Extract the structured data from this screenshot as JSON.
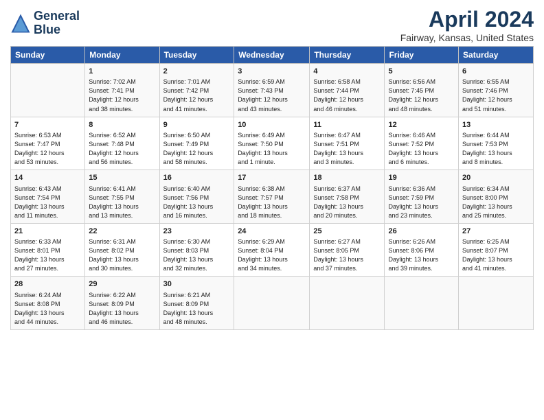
{
  "header": {
    "logo_line1": "General",
    "logo_line2": "Blue",
    "title": "April 2024",
    "subtitle": "Fairway, Kansas, United States"
  },
  "columns": [
    "Sunday",
    "Monday",
    "Tuesday",
    "Wednesday",
    "Thursday",
    "Friday",
    "Saturday"
  ],
  "weeks": [
    [
      {
        "num": "",
        "info": ""
      },
      {
        "num": "1",
        "info": "Sunrise: 7:02 AM\nSunset: 7:41 PM\nDaylight: 12 hours\nand 38 minutes."
      },
      {
        "num": "2",
        "info": "Sunrise: 7:01 AM\nSunset: 7:42 PM\nDaylight: 12 hours\nand 41 minutes."
      },
      {
        "num": "3",
        "info": "Sunrise: 6:59 AM\nSunset: 7:43 PM\nDaylight: 12 hours\nand 43 minutes."
      },
      {
        "num": "4",
        "info": "Sunrise: 6:58 AM\nSunset: 7:44 PM\nDaylight: 12 hours\nand 46 minutes."
      },
      {
        "num": "5",
        "info": "Sunrise: 6:56 AM\nSunset: 7:45 PM\nDaylight: 12 hours\nand 48 minutes."
      },
      {
        "num": "6",
        "info": "Sunrise: 6:55 AM\nSunset: 7:46 PM\nDaylight: 12 hours\nand 51 minutes."
      }
    ],
    [
      {
        "num": "7",
        "info": "Sunrise: 6:53 AM\nSunset: 7:47 PM\nDaylight: 12 hours\nand 53 minutes."
      },
      {
        "num": "8",
        "info": "Sunrise: 6:52 AM\nSunset: 7:48 PM\nDaylight: 12 hours\nand 56 minutes."
      },
      {
        "num": "9",
        "info": "Sunrise: 6:50 AM\nSunset: 7:49 PM\nDaylight: 12 hours\nand 58 minutes."
      },
      {
        "num": "10",
        "info": "Sunrise: 6:49 AM\nSunset: 7:50 PM\nDaylight: 13 hours\nand 1 minute."
      },
      {
        "num": "11",
        "info": "Sunrise: 6:47 AM\nSunset: 7:51 PM\nDaylight: 13 hours\nand 3 minutes."
      },
      {
        "num": "12",
        "info": "Sunrise: 6:46 AM\nSunset: 7:52 PM\nDaylight: 13 hours\nand 6 minutes."
      },
      {
        "num": "13",
        "info": "Sunrise: 6:44 AM\nSunset: 7:53 PM\nDaylight: 13 hours\nand 8 minutes."
      }
    ],
    [
      {
        "num": "14",
        "info": "Sunrise: 6:43 AM\nSunset: 7:54 PM\nDaylight: 13 hours\nand 11 minutes."
      },
      {
        "num": "15",
        "info": "Sunrise: 6:41 AM\nSunset: 7:55 PM\nDaylight: 13 hours\nand 13 minutes."
      },
      {
        "num": "16",
        "info": "Sunrise: 6:40 AM\nSunset: 7:56 PM\nDaylight: 13 hours\nand 16 minutes."
      },
      {
        "num": "17",
        "info": "Sunrise: 6:38 AM\nSunset: 7:57 PM\nDaylight: 13 hours\nand 18 minutes."
      },
      {
        "num": "18",
        "info": "Sunrise: 6:37 AM\nSunset: 7:58 PM\nDaylight: 13 hours\nand 20 minutes."
      },
      {
        "num": "19",
        "info": "Sunrise: 6:36 AM\nSunset: 7:59 PM\nDaylight: 13 hours\nand 23 minutes."
      },
      {
        "num": "20",
        "info": "Sunrise: 6:34 AM\nSunset: 8:00 PM\nDaylight: 13 hours\nand 25 minutes."
      }
    ],
    [
      {
        "num": "21",
        "info": "Sunrise: 6:33 AM\nSunset: 8:01 PM\nDaylight: 13 hours\nand 27 minutes."
      },
      {
        "num": "22",
        "info": "Sunrise: 6:31 AM\nSunset: 8:02 PM\nDaylight: 13 hours\nand 30 minutes."
      },
      {
        "num": "23",
        "info": "Sunrise: 6:30 AM\nSunset: 8:03 PM\nDaylight: 13 hours\nand 32 minutes."
      },
      {
        "num": "24",
        "info": "Sunrise: 6:29 AM\nSunset: 8:04 PM\nDaylight: 13 hours\nand 34 minutes."
      },
      {
        "num": "25",
        "info": "Sunrise: 6:27 AM\nSunset: 8:05 PM\nDaylight: 13 hours\nand 37 minutes."
      },
      {
        "num": "26",
        "info": "Sunrise: 6:26 AM\nSunset: 8:06 PM\nDaylight: 13 hours\nand 39 minutes."
      },
      {
        "num": "27",
        "info": "Sunrise: 6:25 AM\nSunset: 8:07 PM\nDaylight: 13 hours\nand 41 minutes."
      }
    ],
    [
      {
        "num": "28",
        "info": "Sunrise: 6:24 AM\nSunset: 8:08 PM\nDaylight: 13 hours\nand 44 minutes."
      },
      {
        "num": "29",
        "info": "Sunrise: 6:22 AM\nSunset: 8:09 PM\nDaylight: 13 hours\nand 46 minutes."
      },
      {
        "num": "30",
        "info": "Sunrise: 6:21 AM\nSunset: 8:09 PM\nDaylight: 13 hours\nand 48 minutes."
      },
      {
        "num": "",
        "info": ""
      },
      {
        "num": "",
        "info": ""
      },
      {
        "num": "",
        "info": ""
      },
      {
        "num": "",
        "info": ""
      }
    ]
  ]
}
